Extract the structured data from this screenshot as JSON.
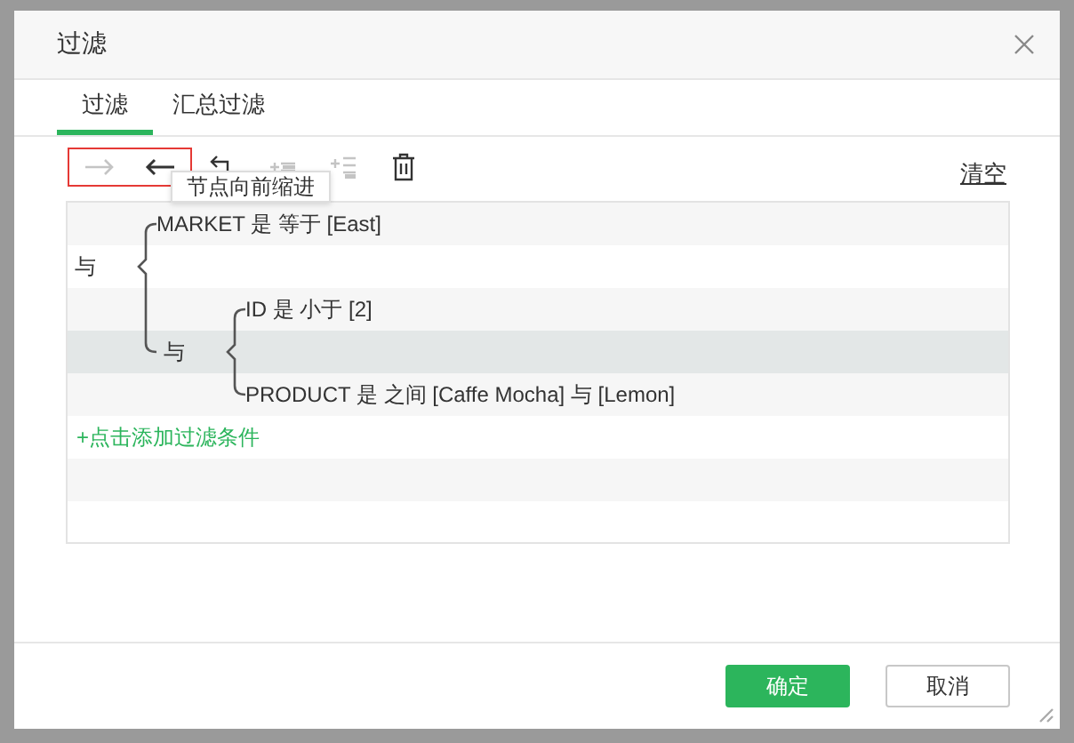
{
  "window": {
    "title": "过滤"
  },
  "tabs": [
    {
      "label": "过滤",
      "selected": true
    },
    {
      "label": "汇总过滤",
      "selected": false
    }
  ],
  "toolbar": {
    "tools": [
      {
        "kind": "indent",
        "disabled": true,
        "highlighted": true
      },
      {
        "kind": "outdent",
        "disabled": false,
        "highlighted": true
      },
      {
        "kind": "wrap",
        "disabled": false,
        "highlighted": false
      },
      {
        "kind": "add-condition",
        "disabled": true,
        "highlighted": false
      },
      {
        "kind": "add-group",
        "disabled": true,
        "highlighted": false
      },
      {
        "kind": "delete",
        "disabled": false,
        "highlighted": false
      }
    ],
    "tooltip": "节点向前缩进",
    "clear": "清空"
  },
  "filter_tree": {
    "kind": "group",
    "label": "与",
    "selected": false,
    "children": [
      {
        "kind": "condition",
        "text": "MARKET 是 等于 [East]",
        "selected": false
      },
      {
        "kind": "group",
        "label": "与",
        "selected": true,
        "children": [
          {
            "kind": "condition",
            "text": "ID 是 小于 [2]",
            "selected": false
          },
          {
            "kind": "condition",
            "text": "PRODUCT 是 之间 [Caffe Mocha] 与 [Lemon]",
            "selected": false
          }
        ]
      }
    ]
  },
  "add_condition": "+点击添加过滤条件",
  "buttons": [
    {
      "label": "确定",
      "kind": "primary"
    },
    {
      "label": "取消",
      "kind": "secondary"
    }
  ]
}
